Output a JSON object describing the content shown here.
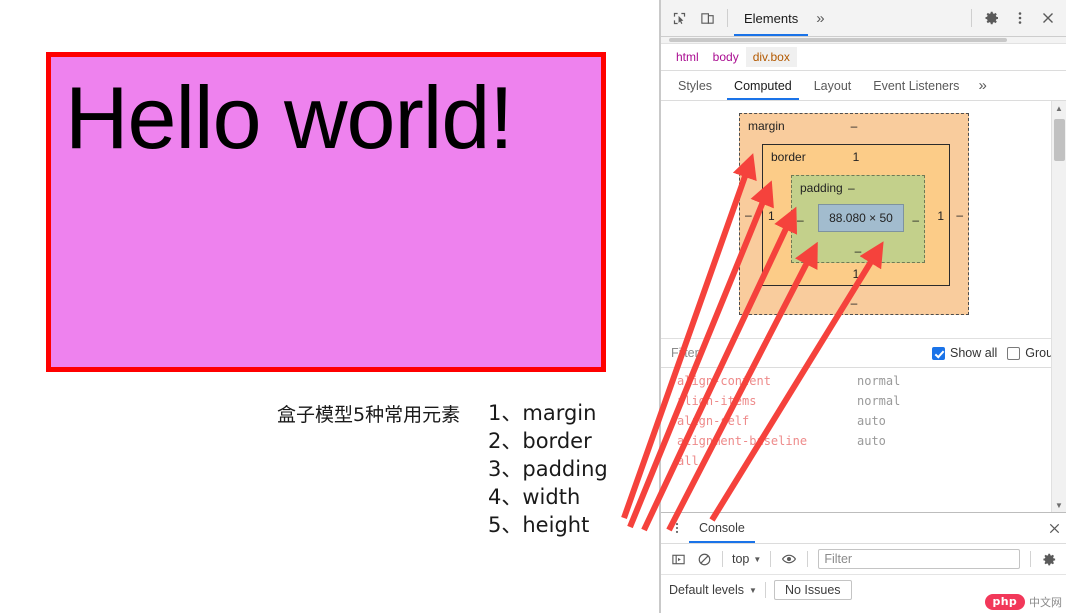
{
  "page": {
    "demo_box": {
      "text": "Hello world!",
      "background_color": "#ee82ee",
      "border_color": "#ff0000"
    },
    "caption_zh": "盒子模型5种常用元素",
    "elements_list": [
      {
        "num": "1、",
        "label": "margin"
      },
      {
        "num": "2、",
        "label": "border"
      },
      {
        "num": "3、",
        "label": "padding"
      },
      {
        "num": "4、",
        "label": "width"
      },
      {
        "num": "5、",
        "label": "height"
      }
    ],
    "annotation_arrow_color": "#f5423c"
  },
  "devtools": {
    "toolbar": {
      "inspect_icon": "inspect-cursor-icon",
      "device_icon": "device-toolbar-icon",
      "active_panel": "Elements",
      "more_panels": "»",
      "settings_icon": "gear-icon",
      "menu_icon": "kebab-menu-icon",
      "close_icon": "close-icon"
    },
    "breadcrumb": [
      {
        "label": "html",
        "selected": false
      },
      {
        "label": "body",
        "selected": false
      },
      {
        "label": "div.box",
        "selected": true
      }
    ],
    "subtabs": [
      {
        "label": "Styles",
        "active": false
      },
      {
        "label": "Computed",
        "active": true
      },
      {
        "label": "Layout",
        "active": false
      },
      {
        "label": "Event Listeners",
        "active": false
      }
    ],
    "subtabs_overflow": "»",
    "box_model": {
      "margin": {
        "label": "margin",
        "top": "–",
        "right": "–",
        "bottom": "–",
        "left": "–"
      },
      "border": {
        "label": "border",
        "top": "1",
        "right": "1",
        "bottom": "1",
        "left": "1"
      },
      "padding": {
        "label": "padding",
        "top": "–",
        "right": "–",
        "bottom": "–",
        "left": "–"
      },
      "content": {
        "size": "88.080 × 50"
      },
      "colors": {
        "margin": "#f9cc9d",
        "border": "#fccc88",
        "padding": "#c3d08b",
        "content": "#a2bcce"
      }
    },
    "filter_bar": {
      "placeholder": "Filter",
      "value": "",
      "show_all_label": "Show all",
      "show_all_checked": true,
      "group_label": "Group",
      "group_checked": false
    },
    "computed_properties": [
      {
        "name": "align-content",
        "value": "normal"
      },
      {
        "name": "align-items",
        "value": "normal"
      },
      {
        "name": "align-self",
        "value": "auto"
      },
      {
        "name": "alignment-baseline",
        "value": "auto"
      },
      {
        "name": "all",
        "value": ""
      }
    ]
  },
  "console_drawer": {
    "menu_icon": "kebab-menu-icon",
    "tab_label": "Console",
    "close_icon": "close-icon",
    "toolbar": {
      "sidebar_icon": "console-sidebar-icon",
      "clear_icon": "clear-console-icon",
      "context_value": "top",
      "eye_icon": "live-expression-eye-icon",
      "filter_placeholder": "Filter",
      "filter_value": "",
      "settings_icon": "gear-icon"
    },
    "statusbar": {
      "levels_label": "Default levels",
      "issues_label": "No Issues"
    }
  },
  "watermark": {
    "brand": "php",
    "suffix": "中文网"
  }
}
